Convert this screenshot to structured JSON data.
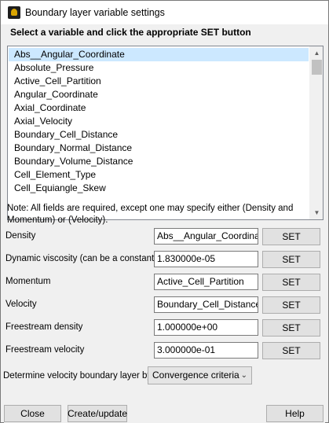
{
  "window": {
    "title": "Boundary layer variable settings"
  },
  "heading": "Select a variable and click the appropriate SET button",
  "variables": [
    "Abs__Angular_Coordinate",
    "Absolute_Pressure",
    "Active_Cell_Partition",
    "Angular_Coordinate",
    "Axial_Coordinate",
    "Axial_Velocity",
    "Boundary_Cell_Distance",
    "Boundary_Normal_Distance",
    "Boundary_Volume_Distance",
    "Cell_Element_Type",
    "Cell_Equiangle_Skew"
  ],
  "selected_variable": "Abs__Angular_Coordinate",
  "note": "Note: All fields are required, except one may specify either (Density and Momentum) or  (Velocity).",
  "rows": [
    {
      "label": "Density",
      "value": "Abs__Angular_Coordinate",
      "button": "SET"
    },
    {
      "label": "Dynamic viscosity (can be a constant)",
      "value": "1.830000e-05",
      "button": "SET"
    },
    {
      "label": "Momentum",
      "value": "Active_Cell_Partition",
      "button": "SET"
    },
    {
      "label": "Velocity",
      "value": "Boundary_Cell_Distance",
      "button": "SET"
    },
    {
      "label": "Freestream density",
      "value": "1.000000e+00",
      "button": "SET"
    },
    {
      "label": "Freestream velocity",
      "value": "3.000000e-01",
      "button": "SET"
    }
  ],
  "method": {
    "label": "Determine velocity boundary layer by",
    "selected": "Convergence criteria"
  },
  "buttons": {
    "close": "Close",
    "create_update": "Create/update",
    "help": "Help"
  },
  "colors": {
    "selection": "#cce8ff",
    "button_face": "#e1e1e1",
    "background": "#f0f0f0"
  },
  "icons": {
    "app": "ensight-app-icon",
    "scroll_up": "triangle-up",
    "scroll_down": "triangle-down",
    "dropdown": "chevron-down"
  }
}
